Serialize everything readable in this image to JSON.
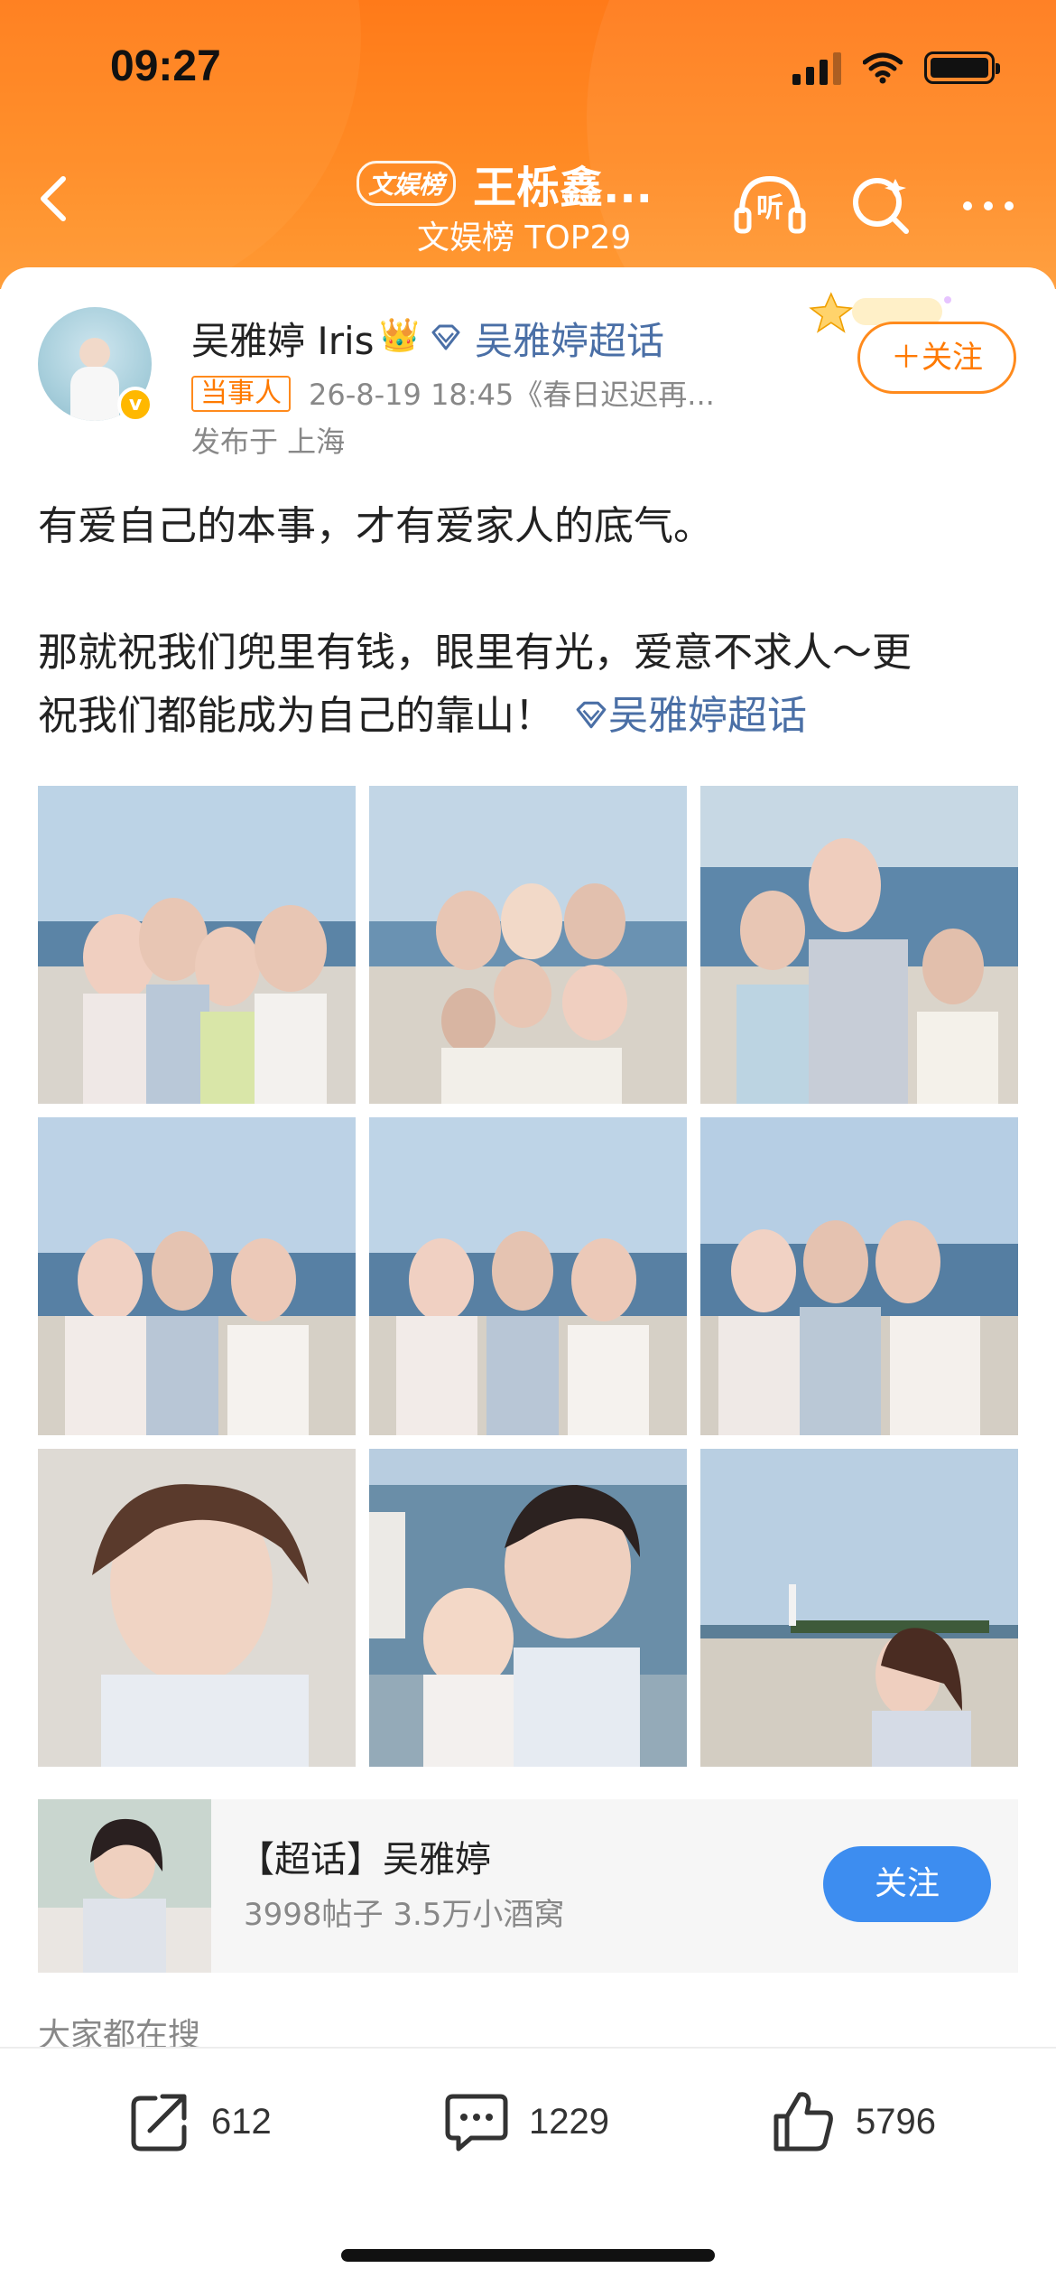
{
  "status_bar": {
    "time": "09:27"
  },
  "header": {
    "badge": "文娱榜",
    "title": "王栎鑫...",
    "subtitle": "文娱榜 TOP29",
    "icons": [
      "back-icon",
      "listen-icon",
      "search-icon",
      "more-icon"
    ],
    "listen_label": "听"
  },
  "post": {
    "author": "吴雅婷 Iris",
    "crown": "👑",
    "supertopic_link": "吴雅婷超话",
    "tag": "当事人",
    "meta": "26-8-19 18:45《春日迟迟再...",
    "location": "发布于 上海",
    "follow_label": "＋关注",
    "text_line1": "有爱自己的本事，才有爱家人的底气。",
    "text_line2": "那就祝我们兜里有钱，眼里有光，爱意不求人～更",
    "text_line3": "祝我们都能成为自己的靠山！",
    "text_topic": "吴雅婷超话"
  },
  "supertopic_card": {
    "title": "【超话】吴雅婷",
    "stats": "3998帖子  3.5万小酒窝",
    "follow_label": "关注"
  },
  "search_hint": "大家都在搜",
  "actions": {
    "share_count": "612",
    "comment_count": "1229",
    "like_count": "5796"
  },
  "colors": {
    "accent_orange": "#ff8a1c",
    "link_blue": "#4a6fa6",
    "button_blue": "#3d8df0"
  }
}
